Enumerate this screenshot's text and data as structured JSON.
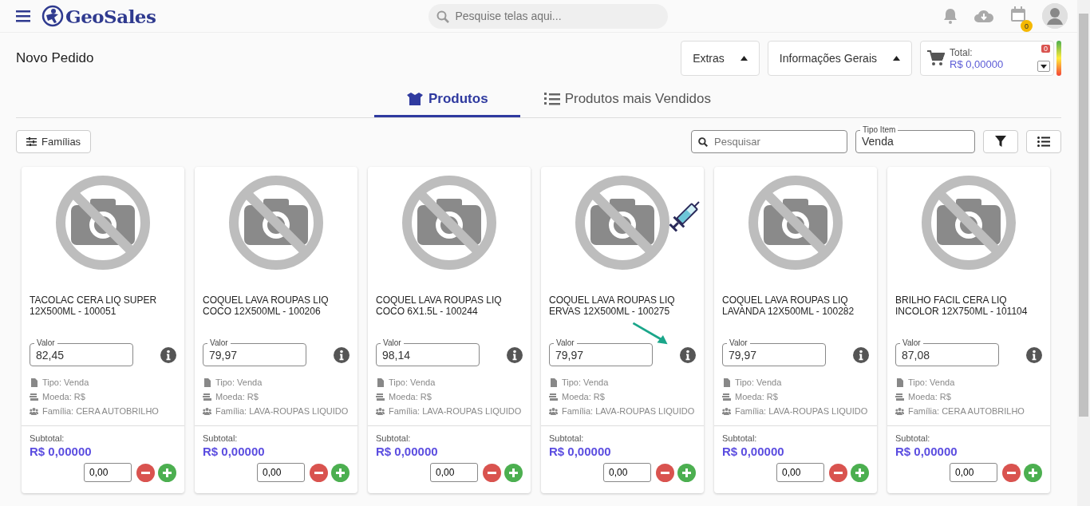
{
  "header": {
    "logo_text": "GeoSales",
    "search_placeholder": "Pesquise telas aqui...",
    "calendar_badge": "0"
  },
  "page_title": "Novo Pedido",
  "toolbar": {
    "extras": "Extras",
    "info": "Informações Gerais",
    "total_label": "Total:",
    "total_value": "R$ 0,00000",
    "total_badge": "0"
  },
  "tabs": [
    {
      "label": "Produtos",
      "selected": true
    },
    {
      "label": "Produtos mais Vendidos",
      "selected": false
    }
  ],
  "filters": {
    "families_button": "Famílias",
    "search_placeholder": "Pesquisar",
    "type_label": "Tipo Item",
    "type_value": "Venda"
  },
  "products": [
    {
      "name": "TACOLAC CERA LIQ SUPER 12X500ML - 100051",
      "value_label": "Valor",
      "value": "82,45",
      "tipo": "Tipo: Venda",
      "moeda": "Moeda: R$",
      "familia": "Família: CERA AUTOBRILHO",
      "subtotal_label": "Subtotal:",
      "subtotal": "R$ 0,00000",
      "quantity": "0,00",
      "syringe": false,
      "pointer_arrow": false
    },
    {
      "name": "COQUEL LAVA ROUPAS LIQ COCO 12X500ML - 100206",
      "value_label": "Valor",
      "value": "79,97",
      "tipo": "Tipo: Venda",
      "moeda": "Moeda: R$",
      "familia": "Família: LAVA-ROUPAS LIQUIDO",
      "subtotal_label": "Subtotal:",
      "subtotal": "R$ 0,00000",
      "quantity": "0,00",
      "syringe": false,
      "pointer_arrow": false
    },
    {
      "name": "COQUEL LAVA ROUPAS LIQ COCO 6X1.5L - 100244",
      "value_label": "Valor",
      "value": "98,14",
      "tipo": "Tipo: Venda",
      "moeda": "Moeda: R$",
      "familia": "Família: LAVA-ROUPAS LIQUIDO",
      "subtotal_label": "Subtotal:",
      "subtotal": "R$ 0,00000",
      "quantity": "0,00",
      "syringe": false,
      "pointer_arrow": false
    },
    {
      "name": "COQUEL LAVA ROUPAS LIQ ERVAS 12X500ML - 100275",
      "value_label": "Valor",
      "value": "79,97",
      "tipo": "Tipo: Venda",
      "moeda": "Moeda: R$",
      "familia": "Família: LAVA-ROUPAS LIQUIDO",
      "subtotal_label": "Subtotal:",
      "subtotal": "R$ 0,00000",
      "quantity": "0,00",
      "syringe": true,
      "pointer_arrow": true
    },
    {
      "name": "COQUEL LAVA ROUPAS LIQ LAVANDA 12X500ML - 100282",
      "value_label": "Valor",
      "value": "79,97",
      "tipo": "Tipo: Venda",
      "moeda": "Moeda: R$",
      "familia": "Família: LAVA-ROUPAS LIQUIDO",
      "subtotal_label": "Subtotal:",
      "subtotal": "R$ 0,00000",
      "quantity": "0,00",
      "syringe": false,
      "pointer_arrow": false
    },
    {
      "name": "BRILHO FACIL CERA LIQ INCOLOR 12X750ML - 101104",
      "value_label": "Valor",
      "value": "87,08",
      "tipo": "Tipo: Venda",
      "moeda": "Moeda: R$",
      "familia": "Família: CERA AUTOBRILHO",
      "subtotal_label": "Subtotal:",
      "subtotal": "R$ 0,00000",
      "quantity": "0,00",
      "syringe": false,
      "pointer_arrow": false
    }
  ]
}
